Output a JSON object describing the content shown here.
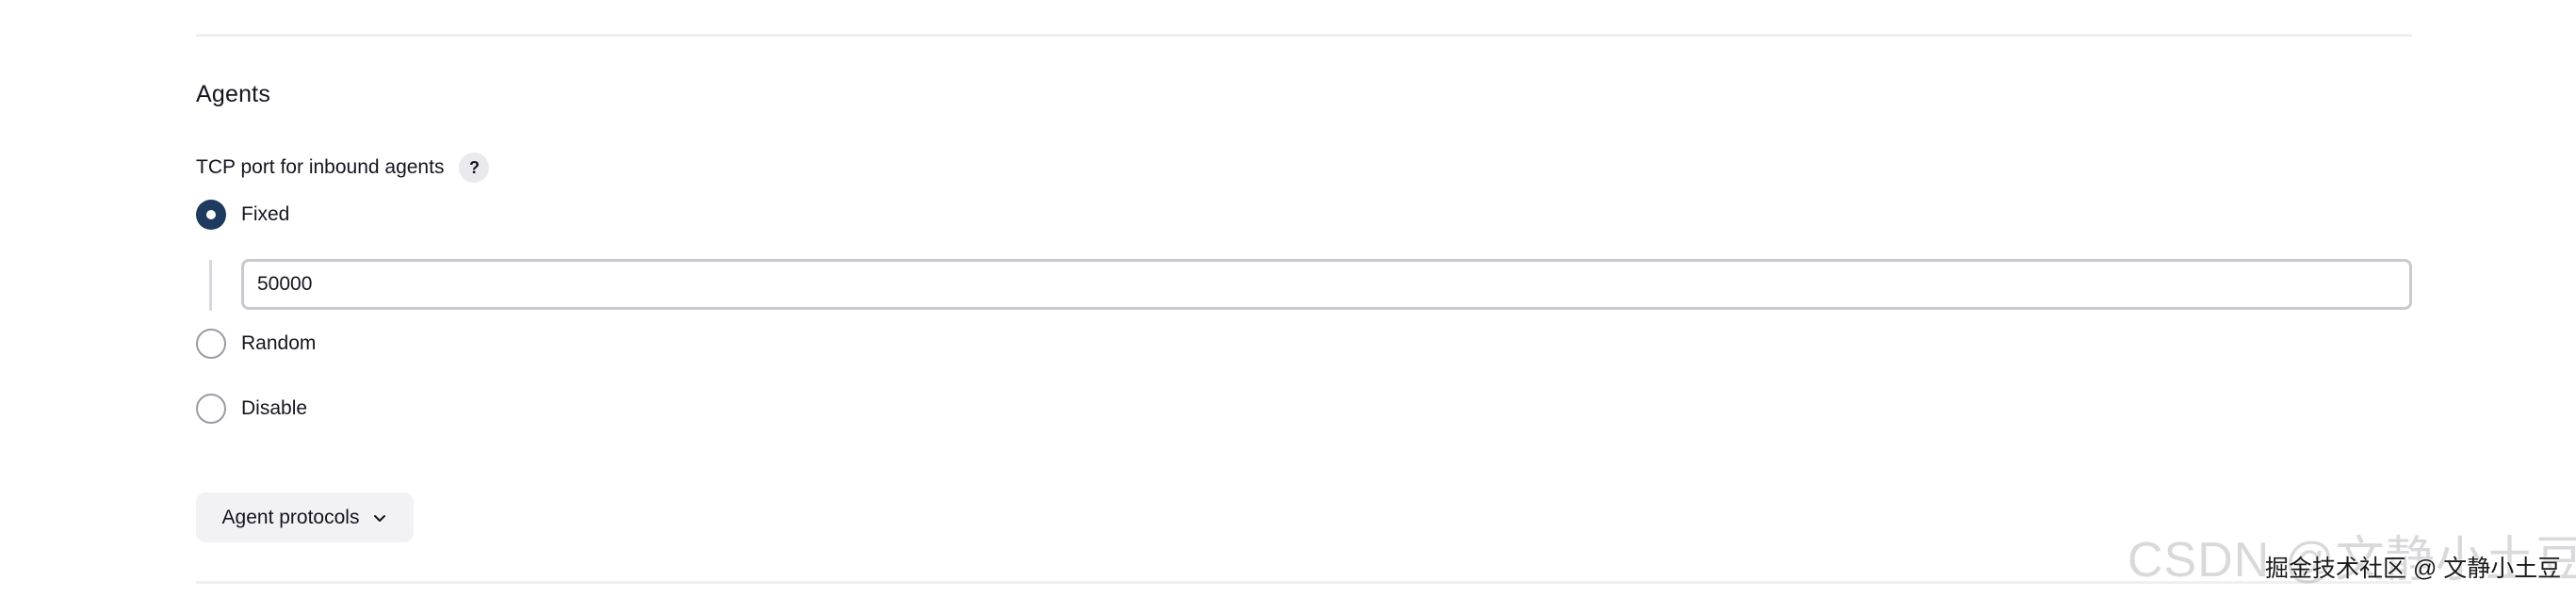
{
  "section": {
    "title": "Agents"
  },
  "tcp_port": {
    "label": "TCP port for inbound agents",
    "help_symbol": "?",
    "options": [
      {
        "label": "Fixed",
        "checked": true
      },
      {
        "label": "Random",
        "checked": false
      },
      {
        "label": "Disable",
        "checked": false
      }
    ],
    "fixed_value": "50000"
  },
  "agent_protocols": {
    "label": "Agent protocols",
    "icon": "chevron-down-icon"
  },
  "watermark": {
    "text": "CSDN @文静小土豆",
    "subtext": "掘金技术社区 @ 文静小土豆"
  },
  "colors": {
    "radio_checked": "#1f3a5f",
    "radio_unchecked_border": "#9a9aa6",
    "input_border": "#c9c9d0",
    "help_bg": "#e9e9ee",
    "dropdown_bg": "#f2f2f5"
  }
}
